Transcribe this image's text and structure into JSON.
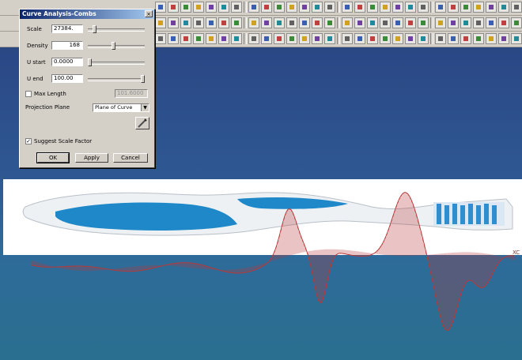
{
  "dialog": {
    "title": "Curve Analysis-Combs",
    "close_glyph": "×",
    "scale_label": "Scale",
    "scale_value": "27384.",
    "density_label": "Density",
    "density_value": "168",
    "ustart_label": "U start",
    "ustart_value": "0.0000",
    "uend_label": "U end",
    "uend_value": "100.00",
    "maxlength_label": "Max Length",
    "maxlength_value": "101.6000",
    "maxlength_checked": false,
    "projection_label": "Projection Plane",
    "projection_value": "Plane of Curve",
    "suggest_label": "Suggest Scale Factor",
    "suggest_checked": true,
    "check_glyph": "✓",
    "ok_label": "OK",
    "apply_label": "Apply",
    "cancel_label": "Cancel"
  },
  "viewport": {
    "axis_label": "XC"
  },
  "colors": {
    "toolbar_bg": "#d4d0c8",
    "title_bar": "#0a246a",
    "comb": "#b83a3a",
    "handle_blue": "#1e88c8"
  }
}
